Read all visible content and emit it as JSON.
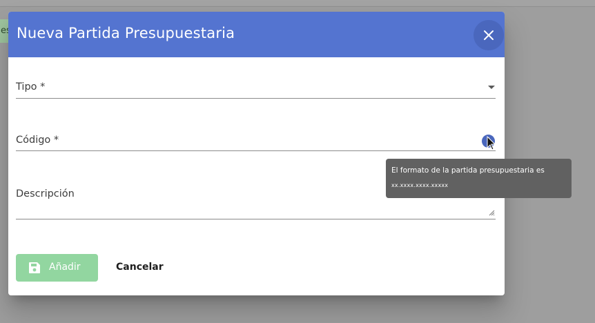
{
  "background": {
    "chip_text": "es"
  },
  "dialog": {
    "title": "Nueva Partida Presupuestaria",
    "close_icon": "close-icon",
    "header_color": "#5474d0"
  },
  "form": {
    "tipo_label": "Tipo *",
    "codigo_label": "Código *",
    "descripcion_label": "Descripción",
    "info_icon": "info-icon"
  },
  "tooltip": {
    "line1": "El formato de la partida presupuestaria es",
    "line2": "xx.xxxx.xxxx.xxxxx"
  },
  "actions": {
    "add_label": "Añadir",
    "add_icon": "save-icon",
    "add_color": "#92d6a0",
    "cancel_label": "Cancelar"
  }
}
